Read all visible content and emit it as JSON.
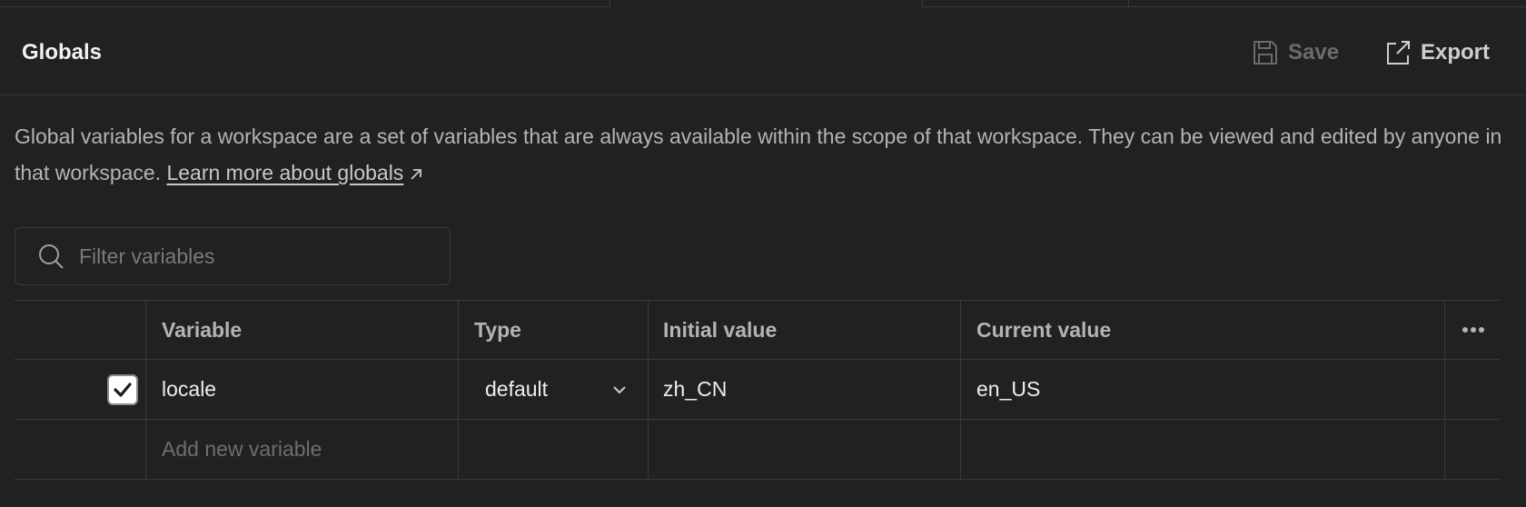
{
  "header": {
    "title": "Globals",
    "save_label": "Save",
    "export_label": "Export"
  },
  "description": {
    "text": "Global variables for a workspace are a set of variables that are always available within the scope of that workspace. They can be viewed and edited by anyone in that workspace. ",
    "link_label": "Learn more about globals"
  },
  "filter": {
    "placeholder": "Filter variables",
    "value": ""
  },
  "table": {
    "columns": [
      "Variable",
      "Type",
      "Initial value",
      "Current value"
    ],
    "rows": [
      {
        "enabled": true,
        "variable": "locale",
        "type": "default",
        "initial_value": "zh_CN",
        "current_value": "en_US"
      }
    ],
    "add_placeholder": "Add new variable"
  },
  "icons": {
    "save": "floppy-disk-icon",
    "export": "export-icon",
    "search": "search-icon",
    "external_link": "arrow-up-right-icon",
    "more": "ellipsis-icon",
    "dropdown": "chevron-down-icon",
    "check": "checkmark-icon"
  },
  "colors": {
    "background": "#212121",
    "border": "#3a3a3a",
    "text_primary": "#f0f0f0",
    "text_muted": "#b4b4b4",
    "disabled": "#6b6b6b"
  }
}
